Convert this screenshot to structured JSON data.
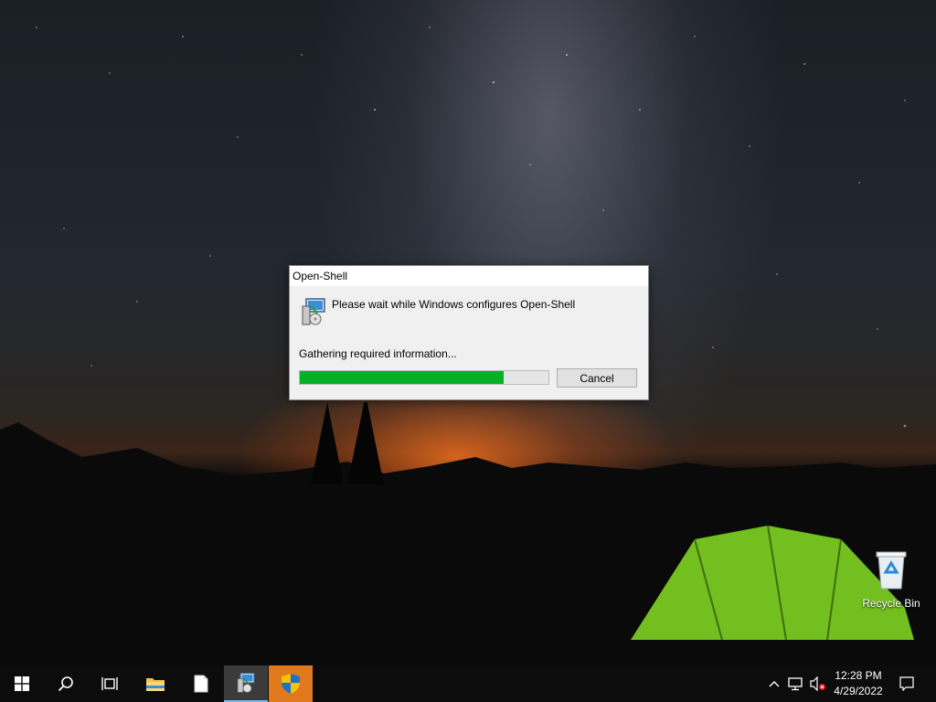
{
  "dialog": {
    "title": "Open-Shell",
    "message": "Please wait while Windows configures Open-Shell",
    "status": "Gathering required information...",
    "progress_fraction": 0.82,
    "cancel_label": "Cancel",
    "icon": "installer-icon"
  },
  "desktop": {
    "icons": [
      {
        "label": "Recycle Bin",
        "icon": "recycle-bin-icon"
      }
    ]
  },
  "taskbar": {
    "items": [
      {
        "icon": "windows-start-icon"
      },
      {
        "icon": "search-icon"
      },
      {
        "icon": "task-view-icon"
      },
      {
        "icon": "file-explorer-icon"
      },
      {
        "icon": "notepad-document-icon"
      },
      {
        "icon": "installer-icon",
        "active": true
      },
      {
        "icon": "uac-shield-icon",
        "highlighted": true
      }
    ],
    "tray": {
      "icons": [
        "chevron-up-icon",
        "network-icon",
        "volume-muted-icon"
      ],
      "time": "12:28 PM",
      "date": "4/29/2022",
      "notification_icon": "action-center-icon"
    }
  },
  "colors": {
    "progress_fill": "#06b025",
    "taskbar": "#0c0c0c",
    "highlight_orange": "#e0791e"
  }
}
